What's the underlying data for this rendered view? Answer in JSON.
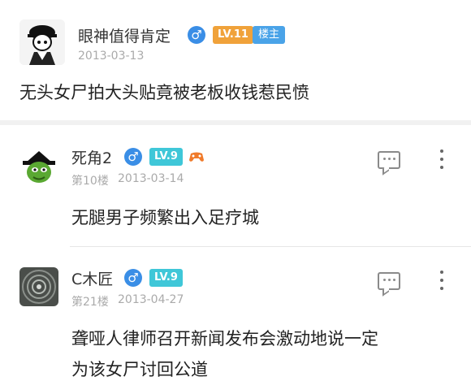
{
  "op_post": {
    "username": "眼神值得肯定",
    "gender_icon": "male-icon",
    "level": "LV.11",
    "owner_badge": "楼主",
    "date": "2013-03-13",
    "content": "无头女尸拍大头贴竟被老板收钱惹民愤"
  },
  "replies": [
    {
      "username": "死角2",
      "gender_icon": "male-icon",
      "level": "LV.9",
      "extra_icon": "gamepad-icon",
      "floor": "第10楼",
      "date": "2013-03-14",
      "content": "无腿男子频繁出入足疗城"
    },
    {
      "username": "C木匠",
      "gender_icon": "male-icon",
      "level": "LV.9",
      "floor": "第21楼",
      "date": "2013-04-27",
      "content_lines": [
        "聋哑人律师召开新闻发布会激动地说一定",
        "为该女尸讨回公道"
      ]
    }
  ],
  "colors": {
    "male": "#3a8ee6",
    "level_orange": "#f0a23a",
    "level_teal": "#3fc7d8",
    "owner": "#4aa3e8"
  },
  "glyphs": {
    "male": "♂"
  }
}
